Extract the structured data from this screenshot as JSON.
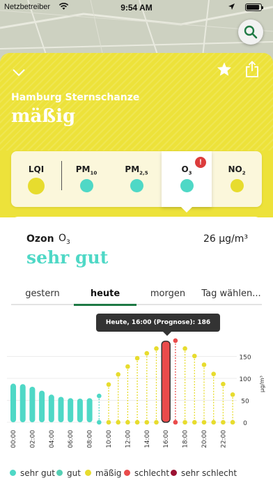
{
  "status_bar": {
    "carrier": "Netzbetreiber",
    "time": "9:54 AM"
  },
  "header": {
    "location": "Hamburg Sternschanze",
    "quality": "mäßig"
  },
  "colors": {
    "sheet": "#ede23a",
    "sehr_gut": "#4fd8c6",
    "gut": "#55cfb4",
    "maessig": "#e7dc2e",
    "schlecht": "#ea4b4b",
    "sehr_schlecht": "#9b1232",
    "accent": "#1f7a45"
  },
  "pollutant_tabs": [
    {
      "label": "LQI",
      "sub": "",
      "color": "#e7dc2e"
    },
    {
      "label": "PM",
      "sub": "10",
      "color": "#4fd8c6"
    },
    {
      "label": "PM",
      "sub": "2,5",
      "color": "#4fd8c6"
    },
    {
      "label": "O",
      "sub": "3",
      "color": "#4fd8c6",
      "active": true,
      "badge": "!"
    },
    {
      "label": "NO",
      "sub": "2",
      "color": "#e7dc2e"
    }
  ],
  "detail": {
    "name": "Ozon",
    "formula": "O",
    "formula_sub": "3",
    "value": "26 µg/m³",
    "status": "sehr gut"
  },
  "day_tabs": [
    "gestern",
    "heute",
    "morgen",
    "Tag wählen..."
  ],
  "tooltip": "Heute, 16:00 (Prognose): 186 µg/m³",
  "chart_data": {
    "type": "bar",
    "unit": "µg/m³",
    "yticks": [
      0,
      50,
      100,
      150
    ],
    "ylim": [
      0,
      190
    ],
    "x": [
      "00:00",
      "01:00",
      "02:00",
      "03:00",
      "04:00",
      "05:00",
      "06:00",
      "07:00",
      "08:00",
      "09:00",
      "10:00",
      "11:00",
      "12:00",
      "13:00",
      "14:00",
      "15:00",
      "16:00",
      "17:00",
      "18:00",
      "19:00",
      "20:00",
      "21:00",
      "22:00",
      "23:00"
    ],
    "xlabels": [
      "00:00",
      "02:00",
      "04:00",
      "06:00",
      "08:00",
      "10:00",
      "12:00",
      "14:00",
      "16:00",
      "18:00",
      "20:00",
      "22:00"
    ],
    "measured": [
      88,
      87,
      81,
      72,
      63,
      58,
      55,
      54,
      55
    ],
    "forecast": [
      60,
      86,
      109,
      127,
      146,
      157,
      168,
      180,
      186,
      168,
      151,
      131,
      110,
      87,
      63
    ],
    "forecast_start_index": 9,
    "selected_index": 16
  },
  "legend": [
    {
      "label": "sehr gut",
      "color": "#4fd8c6"
    },
    {
      "label": "gut",
      "color": "#55cfb4"
    },
    {
      "label": "mäßig",
      "color": "#e7dc2e"
    },
    {
      "label": "schlecht",
      "color": "#ea4b4b"
    },
    {
      "label": "sehr schlecht",
      "color": "#9b1232"
    }
  ]
}
